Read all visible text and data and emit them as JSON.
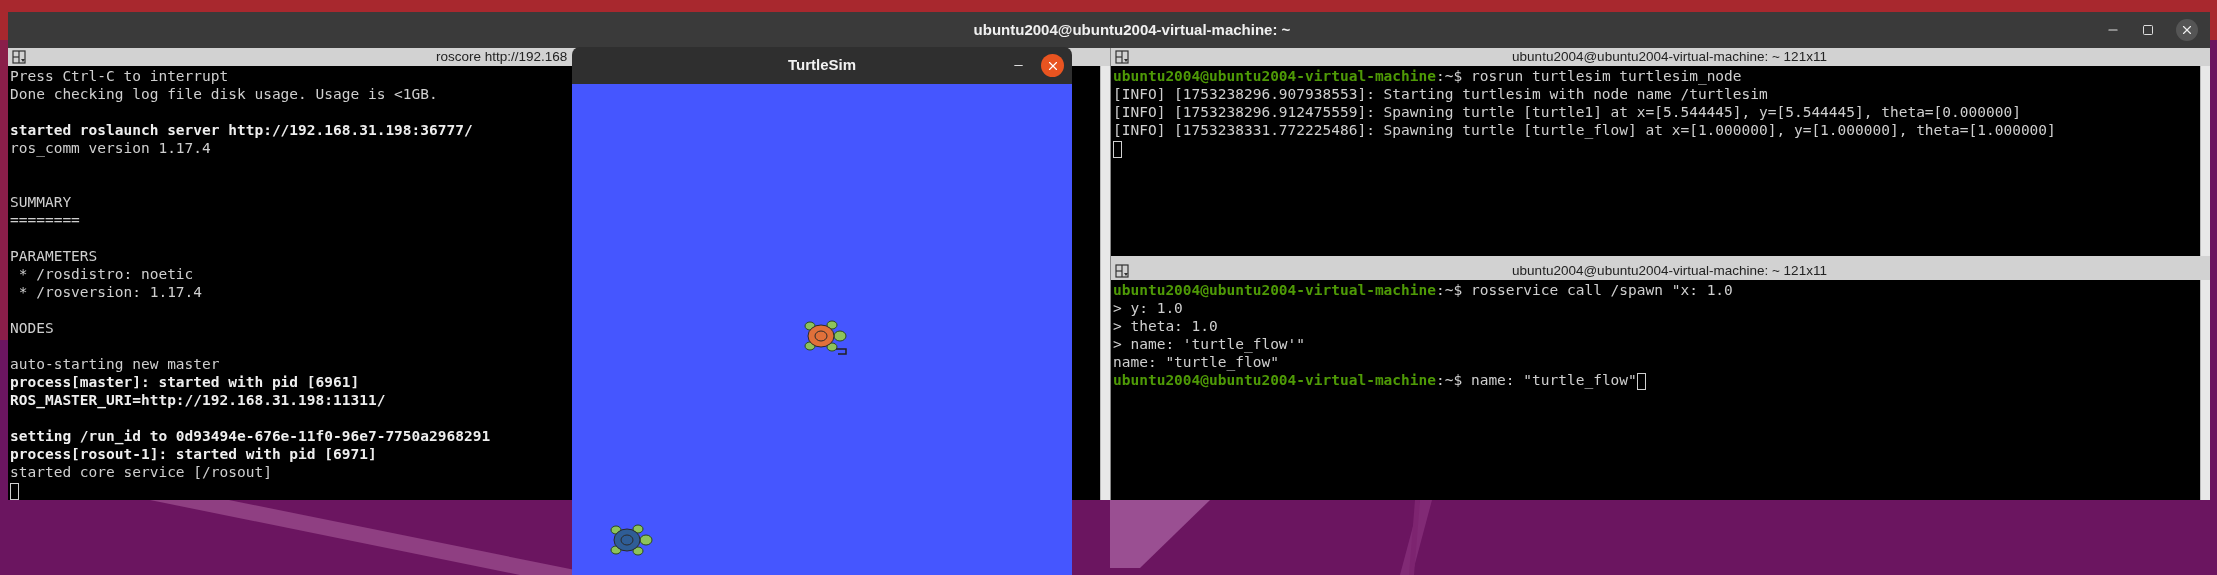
{
  "main_window": {
    "title": "ubuntu2004@ubuntu2004-virtual-machine: ~"
  },
  "terminals": [
    {
      "title": "roscore http://192.168",
      "lines": [
        {
          "kind": "text",
          "text": "Press Ctrl-C to interrupt",
          "bold": false
        },
        {
          "kind": "text",
          "text": "Done checking log file disk usage. Usage is <1GB.",
          "bold": false
        },
        {
          "kind": "blank"
        },
        {
          "kind": "text",
          "text": "started roslaunch server http://192.168.31.198:36777/",
          "bold": true
        },
        {
          "kind": "text",
          "text": "ros_comm version 1.17.4",
          "bold": false
        },
        {
          "kind": "blank"
        },
        {
          "kind": "blank"
        },
        {
          "kind": "text",
          "text": "SUMMARY",
          "bold": false
        },
        {
          "kind": "text",
          "text": "========",
          "bold": false
        },
        {
          "kind": "blank"
        },
        {
          "kind": "text",
          "text": "PARAMETERS",
          "bold": false
        },
        {
          "kind": "text",
          "text": " * /rosdistro: noetic",
          "bold": false
        },
        {
          "kind": "text",
          "text": " * /rosversion: 1.17.4",
          "bold": false
        },
        {
          "kind": "blank"
        },
        {
          "kind": "text",
          "text": "NODES",
          "bold": false
        },
        {
          "kind": "blank"
        },
        {
          "kind": "text",
          "text": "auto-starting new master",
          "bold": false
        },
        {
          "kind": "text",
          "text": "process[master]: started with pid [6961]",
          "bold": true
        },
        {
          "kind": "text",
          "text": "ROS_MASTER_URI=http://192.168.31.198:11311/",
          "bold": true
        },
        {
          "kind": "blank"
        },
        {
          "kind": "text",
          "text": "setting /run_id to 0d93494e-676e-11f0-96e7-7750a2968291",
          "bold": true
        },
        {
          "kind": "text",
          "text": "process[rosout-1]: started with pid [6971]",
          "bold": true
        },
        {
          "kind": "text",
          "text": "started core service [/rosout]",
          "bold": false
        },
        {
          "kind": "blank",
          "cursor": true
        }
      ]
    },
    {
      "title": "ubuntu2004@ubuntu2004-virtual-machine: ~ 121x11",
      "lines": [
        {
          "kind": "prompt",
          "prompt": "ubuntu2004@ubuntu2004-virtual-machine",
          "command": ":~$ rosrun turtlesim turtlesim_node"
        },
        {
          "kind": "text",
          "text": "[INFO] [1753238296.907938553]: Starting turtlesim with node name /turtlesim",
          "bold": false
        },
        {
          "kind": "text",
          "text": "[INFO] [1753238296.912475559]: Spawning turtle [turtle1] at x=[5.544445], y=[5.544445], theta=[0.000000]",
          "bold": false
        },
        {
          "kind": "text",
          "text": "[INFO] [1753238331.772225486]: Spawning turtle [turtle_flow] at x=[1.000000], y=[1.000000], theta=[1.000000]",
          "bold": false
        },
        {
          "kind": "blank",
          "cursor": true
        }
      ]
    },
    {
      "title": "ubuntu2004@ubuntu2004-virtual-machine: ~ 121x11",
      "lines": [
        {
          "kind": "prompt",
          "prompt": "ubuntu2004@ubuntu2004-virtual-machine",
          "command": ":~$ rosservice call /spawn \"x: 1.0"
        },
        {
          "kind": "text",
          "text": "> y: 1.0",
          "bold": false
        },
        {
          "kind": "text",
          "text": "> theta: 1.0",
          "bold": false
        },
        {
          "kind": "text",
          "text": "> name: 'turtle_flow'\"",
          "bold": false
        },
        {
          "kind": "text",
          "text": "name: \"turtle_flow\"",
          "bold": false
        },
        {
          "kind": "prompt",
          "prompt": "ubuntu2004@ubuntu2004-virtual-machine",
          "command": ":~$ name: \"turtle_flow\"",
          "cursor": true
        }
      ]
    }
  ],
  "turtlesim": {
    "title": "TurtleSim",
    "turtles": [
      {
        "color": "#e0703a"
      },
      {
        "color": "#2f5d96"
      }
    ]
  }
}
